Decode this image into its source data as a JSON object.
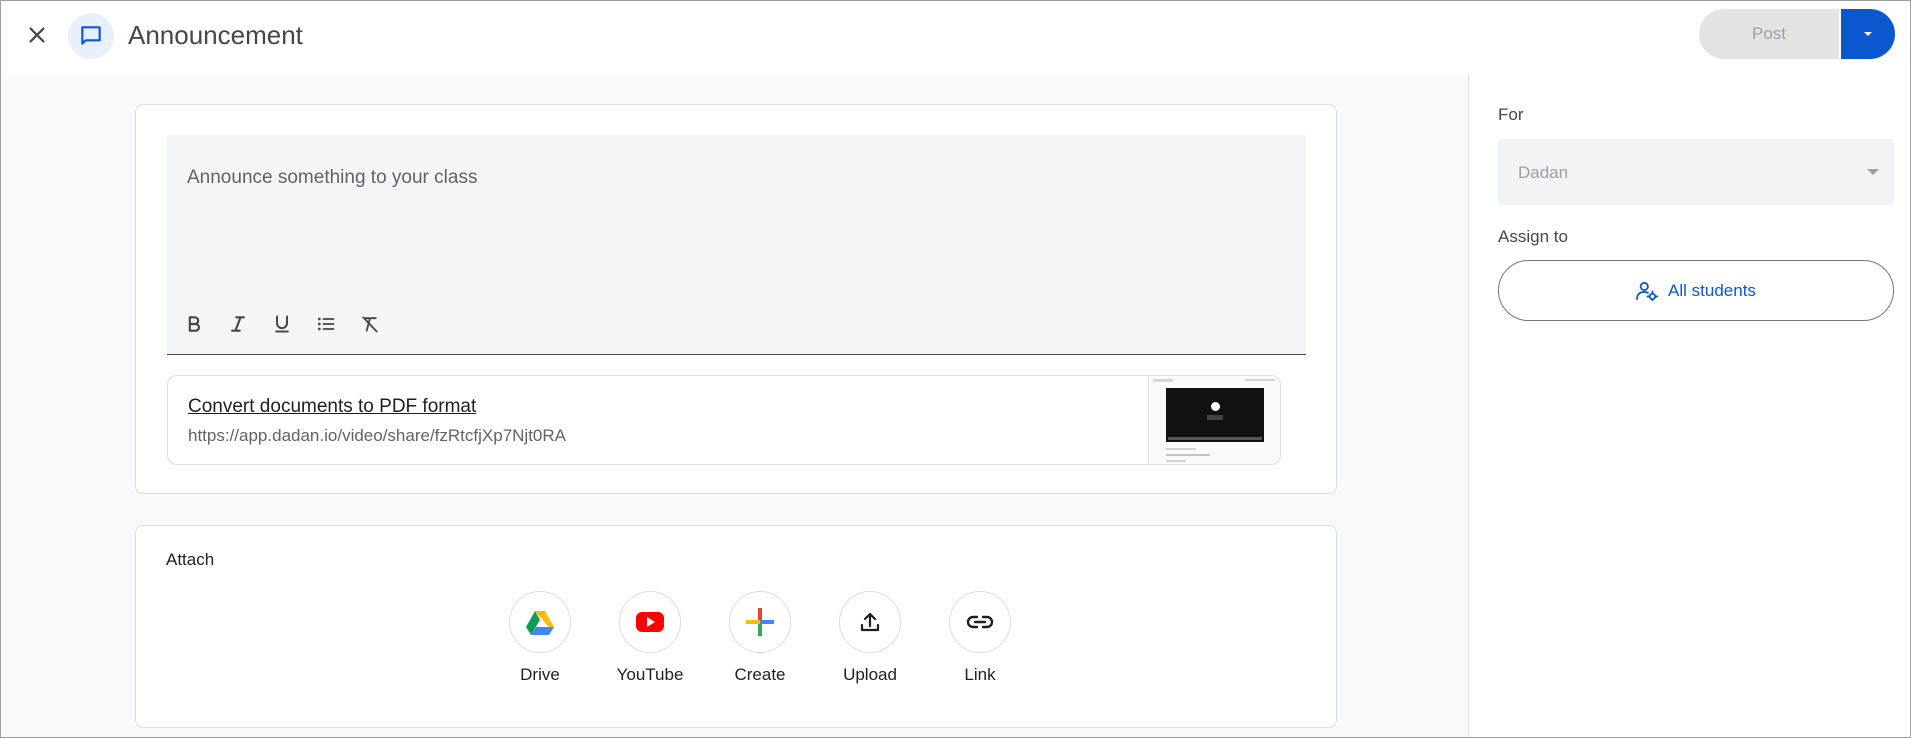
{
  "header": {
    "title": "Announcement",
    "post_label": "Post",
    "close_icon": "close-icon",
    "announcement_icon": "chat-bubble-icon"
  },
  "composer": {
    "placeholder": "Announce something to your class",
    "toolbar": [
      "bold",
      "italic",
      "underline",
      "bulleted-list",
      "clear-formatting"
    ]
  },
  "link_attachment": {
    "title": "Convert documents to PDF format",
    "url": "https://app.dadan.io/video/share/fzRtcfjXp7Njt0RA"
  },
  "attach": {
    "label": "Attach",
    "items": [
      {
        "label": "Drive",
        "icon": "google-drive-icon"
      },
      {
        "label": "YouTube",
        "icon": "youtube-icon"
      },
      {
        "label": "Create",
        "icon": "plus-icon"
      },
      {
        "label": "Upload",
        "icon": "upload-icon"
      },
      {
        "label": "Link",
        "icon": "link-icon"
      }
    ]
  },
  "side": {
    "for_label": "For",
    "for_value": "Dadan",
    "assign_label": "Assign to",
    "assign_value": "All students"
  },
  "colors": {
    "accent": "#0b57d0",
    "post_disabled_bg": "#e3e3e3",
    "main_bg": "#f8f9fa"
  }
}
